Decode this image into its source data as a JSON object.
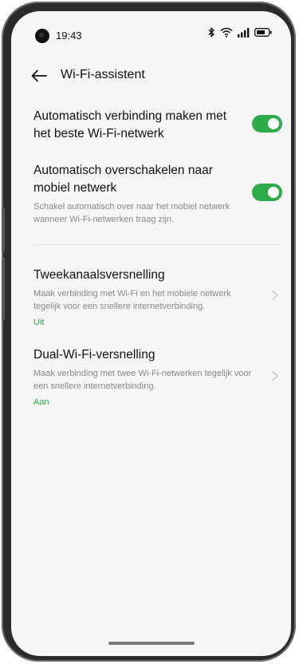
{
  "status_bar": {
    "time": "19:43",
    "icons": [
      "camera-icon",
      "bluetooth-icon",
      "wifi-icon",
      "signal-icon",
      "battery-icon"
    ]
  },
  "header": {
    "back_icon": "back-arrow-icon",
    "title": "Wi-Fi-assistent"
  },
  "settings": [
    {
      "title": "Automatisch verbinding maken met het beste Wi-Fi-netwerk",
      "control": "toggle",
      "enabled": true
    },
    {
      "title": "Automatisch overschakelen naar mobiel netwerk",
      "description": "Schakel automatisch over naar het mobiel netwerk wanneer Wi-Fi-netwerken traag zijn.",
      "control": "toggle",
      "enabled": true
    },
    {
      "title": "Tweekanaalsversnelling",
      "description": "Maak verbinding met Wi-Fi en het mobiele netwerk tegelijk voor een snellere internetverbinding.",
      "status": "Uit",
      "control": "chevron"
    },
    {
      "title": "Dual-Wi-Fi-versnelling",
      "description": "Maak verbinding met twee Wi-Fi-netwerken tegelijk voor een snellere internetverbinding.",
      "status": "Aan",
      "control": "chevron"
    }
  ],
  "colors": {
    "accent": "#2eab4a",
    "background": "#f6f6f6",
    "text_primary": "#111111",
    "text_secondary": "#888888"
  }
}
